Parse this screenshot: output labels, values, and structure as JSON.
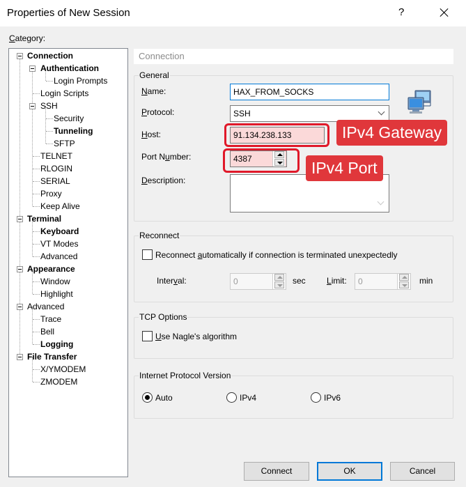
{
  "window": {
    "title": "Properties of New Session",
    "help_glyph": "?"
  },
  "category": {
    "label_prefix": "C",
    "label_rest": "ategory:",
    "tree": [
      {
        "label": "Connection",
        "bold": true
      },
      {
        "label": "Authentication",
        "bold": true
      },
      {
        "label": "Login Prompts"
      },
      {
        "label": "Login Scripts"
      },
      {
        "label": "SSH"
      },
      {
        "label": "Security"
      },
      {
        "label": "Tunneling",
        "bold": true
      },
      {
        "label": "SFTP"
      },
      {
        "label": "TELNET"
      },
      {
        "label": "RLOGIN"
      },
      {
        "label": "SERIAL"
      },
      {
        "label": "Proxy"
      },
      {
        "label": "Keep Alive"
      },
      {
        "label": "Terminal",
        "bold": true
      },
      {
        "label": "Keyboard",
        "bold": true
      },
      {
        "label": "VT Modes"
      },
      {
        "label": "Advanced"
      },
      {
        "label": "Appearance",
        "bold": true
      },
      {
        "label": "Window"
      },
      {
        "label": "Highlight"
      },
      {
        "label": "Advanced"
      },
      {
        "label": "Trace"
      },
      {
        "label": "Bell"
      },
      {
        "label": "Logging",
        "bold": true
      },
      {
        "label": "File Transfer",
        "bold": true
      },
      {
        "label": "X/YMODEM"
      },
      {
        "label": "ZMODEM"
      }
    ]
  },
  "panel": {
    "header": "Connection",
    "general": {
      "title": "General",
      "name_label_u": "N",
      "name_label_rest": "ame:",
      "name_value": "HAX_FROM_SOCKS",
      "protocol_label_u": "P",
      "protocol_label_rest": "rotocol:",
      "protocol_value": "SSH",
      "host_label_u": "H",
      "host_label_rest": "ost:",
      "host_value": "91.134.238.133",
      "port_label_pre": "Port N",
      "port_label_u": "u",
      "port_label_rest": "mber:",
      "port_value": "4387",
      "description_label_u": "D",
      "description_label_rest": "escription:",
      "description_value": ""
    },
    "reconnect": {
      "title": "Reconnect",
      "checkbox_label_pre": "Reconnect ",
      "checkbox_label_u": "a",
      "checkbox_label_rest": "utomatically if connection is terminated unexpectedly",
      "interval_label_pre": "Inter",
      "interval_label_u": "v",
      "interval_label_rest": "al:",
      "interval_value": "0",
      "interval_unit": "sec",
      "limit_label_u": "L",
      "limit_label_rest": "imit:",
      "limit_value": "0",
      "limit_unit": "min"
    },
    "tcp": {
      "title": "TCP Options",
      "nagle_label_u": "U",
      "nagle_label_rest": "se Nagle's algorithm"
    },
    "ip_version": {
      "title": "Internet Protocol Version",
      "options": [
        "Auto",
        "IPv4",
        "IPv6"
      ],
      "selected": "Auto"
    }
  },
  "annotations": {
    "gateway_callout": "IPv4 Gateway",
    "port_callout": "IPv4 Port",
    "highlight_color": "#e0192a"
  },
  "buttons": {
    "connect": "Connect",
    "ok": "OK",
    "cancel": "Cancel"
  }
}
